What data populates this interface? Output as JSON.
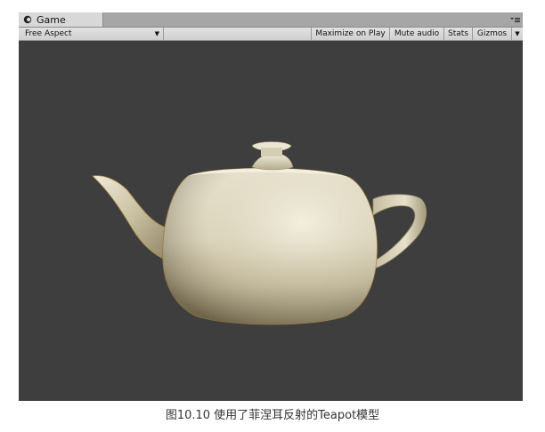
{
  "window": {
    "tab_title": "Game",
    "tab_icon": "unity-game-icon"
  },
  "toolbar": {
    "aspect_label": "Free Aspect",
    "maximize_label": "Maximize on Play",
    "mute_label": "Mute audio",
    "stats_label": "Stats",
    "gizmos_label": "Gizmos"
  },
  "viewport": {
    "background": "#3e3e3e",
    "object": "teapot"
  },
  "caption": {
    "text": "图10.10 使用了菲涅耳反射的Teapot模型"
  }
}
